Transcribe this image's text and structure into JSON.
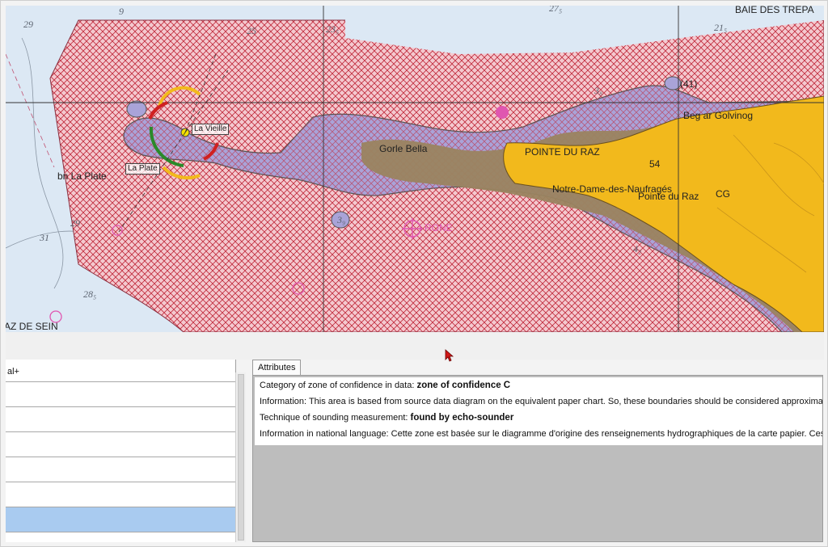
{
  "map": {
    "labels": {
      "baie": "BAIE DES TREPA",
      "raz_de_sein": "AZ DE SEIN",
      "pointe_du_raz_caps": "POINTE DU RAZ",
      "pointe_du_raz": "Pointe du Raz",
      "beg_ar_golvinog": "Beg ar Golvinog",
      "notre_dame": "Notre-Dame-des-Naufragés",
      "la_vieille": "La Vieille",
      "la_plate_box": "La Plate",
      "la_plate": "bn La Plate",
      "gorlebella": "Gorle Bella",
      "cg": "CG",
      "num_54": "54",
      "num_41": "(41)",
      "rond": "RONE"
    },
    "depths": {
      "d29a": "29",
      "d9": "9",
      "d25": "25",
      "d23": "23₅",
      "d27": "27₅",
      "d21": "21₅",
      "d29b": "29",
      "d31": "31",
      "d28": "28₅",
      "d42": "4₂",
      "d3a": "3₈",
      "d3b": "3₉"
    }
  },
  "left_panel": {
    "rows": [
      "al+",
      "",
      "",
      "",
      "",
      "",
      ""
    ],
    "selected_index": 6
  },
  "attributes": {
    "tab_label": "Attributes",
    "rows": [
      {
        "key": "Category of zone of confidence in data: ",
        "value": "zone of confidence C"
      },
      {
        "key": "Information: This area is based from source data diagram on the equivalent paper chart. So, these boundaries should be considered approximat",
        "value": ""
      },
      {
        "key": "Technique of sounding measurement: ",
        "value": "found by echo-sounder"
      },
      {
        "key": "Information in national language: Cette zone est basée sur le diagramme d'origine des renseignements hydrographiques de la carte papier. Ces l",
        "value": ""
      }
    ]
  },
  "colors": {
    "sea": "#dce8f4",
    "zoc_hatch": "#c0283a",
    "zoc_fill": "#f4c9cf",
    "shallow": "#a9a3d8",
    "intertidal": "#9a8460",
    "land": "#f2b91c"
  }
}
